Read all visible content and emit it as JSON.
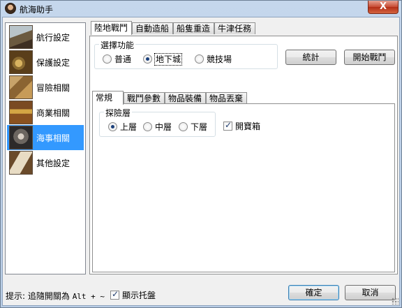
{
  "window": {
    "title": "航海助手",
    "close_glyph": "X"
  },
  "sidebar": {
    "items": [
      {
        "label": "航行設定",
        "icon": "sailing-ship-icon"
      },
      {
        "label": "保護設定",
        "icon": "treasure-coins-icon"
      },
      {
        "label": "冒險相關",
        "icon": "treasure-map-icon"
      },
      {
        "label": "商業相關",
        "icon": "treasure-chest-icon"
      },
      {
        "label": "海事相關",
        "icon": "sea-battle-icon",
        "selected": true
      },
      {
        "label": "其他設定",
        "icon": "open-book-icon"
      }
    ]
  },
  "main": {
    "tabs": [
      {
        "label": "陸地戰鬥",
        "active": true
      },
      {
        "label": "自動造船"
      },
      {
        "label": "船隻重造"
      },
      {
        "label": "牛津任務"
      }
    ],
    "function_group": {
      "legend": "選擇功能",
      "options": [
        {
          "label": "普通",
          "checked": false
        },
        {
          "label": "地下城",
          "checked": true
        },
        {
          "label": "競技場",
          "checked": false
        }
      ]
    },
    "stats_button": "統計",
    "start_battle_button": "開始戰鬥",
    "sub_tabs": [
      {
        "label": "常規",
        "active": true
      },
      {
        "label": "戰鬥參數"
      },
      {
        "label": "物品裝備"
      },
      {
        "label": "物品丟棄"
      }
    ],
    "explore_group": {
      "legend": "探險層",
      "options": [
        {
          "label": "上層",
          "checked": true
        },
        {
          "label": "中層",
          "checked": false
        },
        {
          "label": "下層",
          "checked": false
        }
      ]
    },
    "open_chest": {
      "label": "開寶箱",
      "checked": true
    }
  },
  "footer": {
    "hint_prefix": "提示: 追隨開關為",
    "hint_shortcut": "Alt + ~",
    "show_tray": {
      "label": "顯示托盤",
      "checked": true
    },
    "ok_button": "確定",
    "cancel_button": "取消"
  },
  "colors": {
    "selection": "#3399ff",
    "titlebar": "#c5d7ec",
    "close": "#c74a32"
  }
}
